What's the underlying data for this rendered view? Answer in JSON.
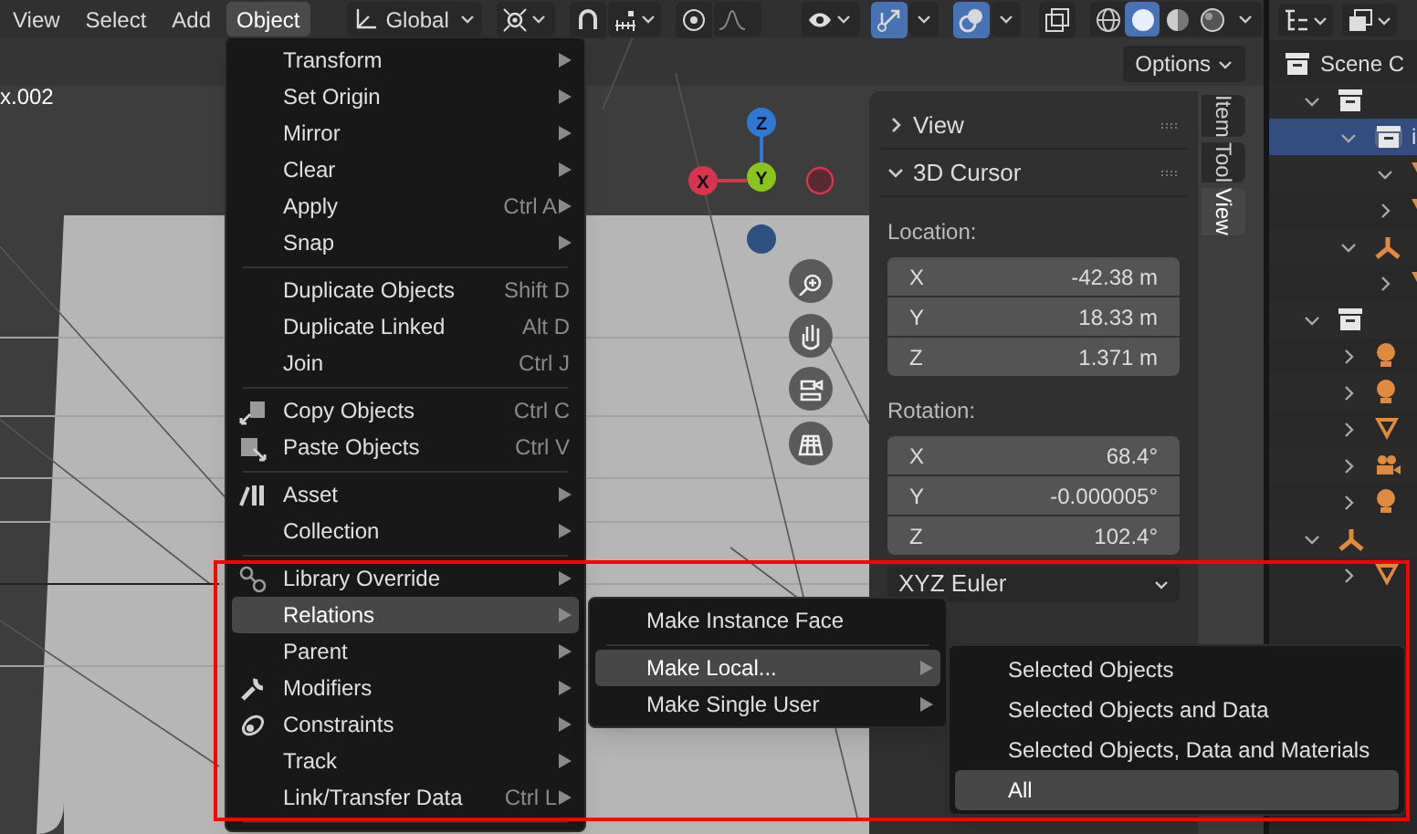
{
  "header_menu": [
    {
      "label": "View",
      "selected": false
    },
    {
      "label": "Select",
      "selected": false
    },
    {
      "label": "Add",
      "selected": false
    },
    {
      "label": "Object",
      "selected": true
    }
  ],
  "toolbar": {
    "orientation": "Global",
    "toggles": [
      {
        "kind": "snap",
        "on": false
      },
      {
        "kind": "proportional",
        "on": false
      },
      {
        "kind": "gizmos",
        "on": true
      },
      {
        "kind": "overlays",
        "on": true
      },
      {
        "kind": "xray",
        "on": false
      }
    ],
    "shading": [
      {
        "kind": "wireframe",
        "selected": false
      },
      {
        "kind": "solid",
        "selected": true
      },
      {
        "kind": "material",
        "selected": false
      },
      {
        "kind": "rendered",
        "selected": false
      }
    ]
  },
  "viewport": {
    "object_label": "x.002",
    "options": "Options",
    "gizmo_axes": [
      {
        "kind": "z",
        "label": "Z"
      },
      {
        "kind": "x",
        "label": "X"
      },
      {
        "kind": "y",
        "label": "Y"
      }
    ]
  },
  "n_panel": {
    "tabs": [
      {
        "label": "Item",
        "selected": false
      },
      {
        "label": "Tool",
        "selected": false
      },
      {
        "label": "View",
        "selected": true
      }
    ],
    "sections": [
      {
        "title": "View",
        "expanded": false
      },
      {
        "title": "3D Cursor",
        "expanded": true
      }
    ],
    "location_label": "Location:",
    "location": [
      {
        "axis": "X",
        "value": "-42.38 m"
      },
      {
        "axis": "Y",
        "value": "18.33 m"
      },
      {
        "axis": "Z",
        "value": "1.371 m"
      }
    ],
    "rotation_label": "Rotation:",
    "rotation": [
      {
        "axis": "X",
        "value": "68.4°"
      },
      {
        "axis": "Y",
        "value": "-0.000005°"
      },
      {
        "axis": "Z",
        "value": "102.4°"
      }
    ],
    "rotation_mode": "XYZ Euler"
  },
  "object_menu": [
    {
      "kind": "item",
      "label": "Transform",
      "submenu": true,
      "selected": false
    },
    {
      "kind": "item",
      "label": "Set Origin",
      "submenu": true,
      "selected": false
    },
    {
      "kind": "item",
      "label": "Mirror",
      "submenu": true,
      "selected": false
    },
    {
      "kind": "item",
      "label": "Clear",
      "submenu": true,
      "selected": false
    },
    {
      "kind": "item",
      "label": "Apply",
      "shortcut": "Ctrl A",
      "submenu": true,
      "selected": false
    },
    {
      "kind": "item",
      "label": "Snap",
      "submenu": true,
      "selected": false
    },
    {
      "kind": "separator"
    },
    {
      "kind": "item",
      "label": "Duplicate Objects",
      "shortcut": "Shift D",
      "submenu": false,
      "selected": false
    },
    {
      "kind": "item",
      "label": "Duplicate Linked",
      "shortcut": "Alt D",
      "submenu": false,
      "selected": false
    },
    {
      "kind": "item",
      "label": "Join",
      "shortcut": "Ctrl J",
      "submenu": false,
      "selected": false
    },
    {
      "kind": "separator"
    },
    {
      "kind": "copy",
      "label": "Copy Objects",
      "shortcut": "Ctrl C",
      "submenu": false,
      "selected": false
    },
    {
      "kind": "paste",
      "label": "Paste Objects",
      "shortcut": "Ctrl V",
      "submenu": false,
      "selected": false
    },
    {
      "kind": "separator"
    },
    {
      "kind": "asset",
      "label": "Asset",
      "submenu": true,
      "selected": false
    },
    {
      "kind": "item",
      "label": "Collection",
      "submenu": true,
      "selected": false
    },
    {
      "kind": "separator"
    },
    {
      "kind": "override",
      "label": "Library Override",
      "submenu": true,
      "selected": false
    },
    {
      "kind": "item",
      "label": "Relations",
      "submenu": true,
      "selected": true
    },
    {
      "kind": "item",
      "label": "Parent",
      "submenu": true,
      "selected": false
    },
    {
      "kind": "wrench",
      "label": "Modifiers",
      "submenu": true,
      "selected": false
    },
    {
      "kind": "constraint",
      "label": "Constraints",
      "submenu": true,
      "selected": false
    },
    {
      "kind": "item",
      "label": "Track",
      "submenu": true,
      "selected": false
    },
    {
      "kind": "item",
      "label": "Link/Transfer Data",
      "shortcut": "Ctrl L",
      "submenu": true,
      "selected": false
    },
    {
      "kind": "separator"
    }
  ],
  "relations_menu": [
    {
      "kind": "item",
      "label": "Make Instance Face",
      "submenu": false,
      "selected": false
    },
    {
      "kind": "separator"
    },
    {
      "kind": "item",
      "label": "Make Local...",
      "submenu": true,
      "selected": true
    },
    {
      "kind": "item",
      "label": "Make Single User",
      "submenu": true,
      "selected": false
    }
  ],
  "make_local_menu": [
    {
      "kind": "item",
      "label": "Selected Objects",
      "submenu": false,
      "selected": false
    },
    {
      "kind": "item",
      "label": "Selected Objects and Data",
      "submenu": false,
      "selected": false
    },
    {
      "kind": "item",
      "label": "Selected Objects, Data and Materials",
      "submenu": false,
      "selected": false
    },
    {
      "kind": "item",
      "label": "All",
      "submenu": false,
      "selected": true
    }
  ],
  "outliner": {
    "tree": [
      {
        "kind": "collection",
        "label": "Scene C",
        "selected": false,
        "children": [
          {
            "kind": "collection",
            "expanded": true,
            "selected": false,
            "children": [
              {
                "kind": "collection",
                "label": "i",
                "expanded": true,
                "selected": true,
                "children": [
                  {
                    "kind": "mesh",
                    "expanded": true,
                    "selected": false
                  },
                  {
                    "kind": "mesh",
                    "expanded": false,
                    "selected": false
                  }
                ]
              },
              {
                "kind": "empty",
                "expanded": true,
                "selected": false,
                "children": [
                  {
                    "kind": "mesh",
                    "expanded": false,
                    "selected": false
                  }
                ]
              }
            ]
          },
          {
            "kind": "collection",
            "expanded": true,
            "selected": false,
            "children": [
              {
                "kind": "light",
                "expanded": false,
                "selected": false
              },
              {
                "kind": "light",
                "expanded": false,
                "selected": false
              },
              {
                "kind": "mesh",
                "expanded": false,
                "selected": false
              },
              {
                "kind": "camera",
                "expanded": false,
                "selected": false
              },
              {
                "kind": "light",
                "expanded": false,
                "selected": false
              }
            ]
          },
          {
            "kind": "empty",
            "expanded": true,
            "selected": false,
            "children": [
              {
                "kind": "mesh",
                "expanded": false,
                "selected": false
              }
            ]
          }
        ]
      }
    ]
  }
}
